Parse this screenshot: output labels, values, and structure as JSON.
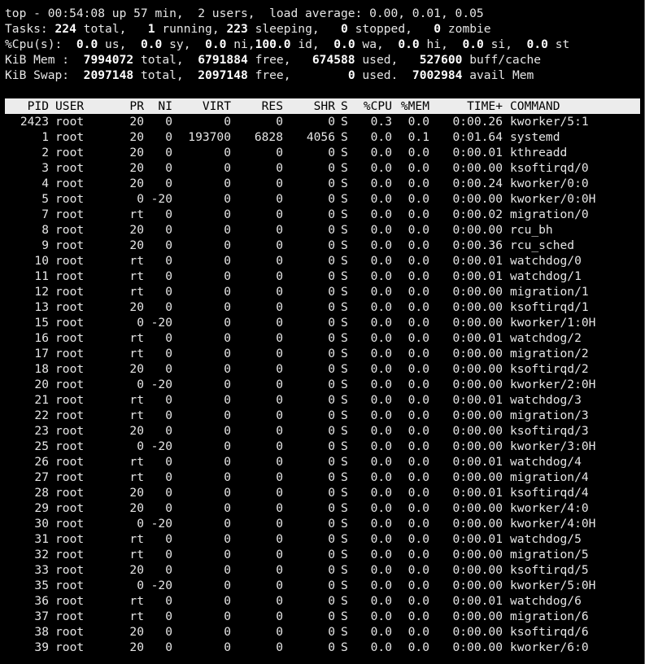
{
  "summary": {
    "line1": "top - 00:54:08 up 57 min,  2 users,  load average: 0.00, 0.01, 0.05",
    "tasks": {
      "label": "Tasks:",
      "total": "224",
      "total_label": "total,",
      "running": "1",
      "running_label": "running,",
      "sleeping": "223",
      "sleeping_label": "sleeping,",
      "stopped": "0",
      "stopped_label": "stopped,",
      "zombie": "0",
      "zombie_label": "zombie"
    },
    "cpu": {
      "label": "%Cpu(s):",
      "us": "0.0",
      "us_label": "us,",
      "sy": "0.0",
      "sy_label": "sy,",
      "ni": "0.0",
      "ni_label": "ni,",
      "id": "100.0",
      "id_label": "id,",
      "wa": "0.0",
      "wa_label": "wa,",
      "hi": "0.0",
      "hi_label": "hi,",
      "si": "0.0",
      "si_label": "si,",
      "st": "0.0",
      "st_label": "st"
    },
    "mem": {
      "label": "KiB Mem :",
      "total": "7994072",
      "total_label": "total,",
      "free": "6791884",
      "free_label": "free,",
      "used": "674588",
      "used_label": "used,",
      "buff": "527600",
      "buff_label": "buff/cache"
    },
    "swap": {
      "label": "KiB Swap:",
      "total": "2097148",
      "total_label": "total,",
      "free": "2097148",
      "free_label": "free,",
      "used": "0",
      "used_label": "used.",
      "avail": "7002984",
      "avail_label": "avail Mem"
    }
  },
  "columns": {
    "pid": "PID",
    "user": "USER",
    "pr": "PR",
    "ni": "NI",
    "virt": "VIRT",
    "res": "RES",
    "shr": "SHR",
    "s": "S",
    "cpu": "%CPU",
    "mem": "%MEM",
    "time": "TIME+",
    "command": "COMMAND"
  },
  "processes": [
    [
      "2423",
      "root",
      "20",
      "0",
      "0",
      "0",
      "0",
      "S",
      "0.3",
      "0.0",
      "0:00.26",
      "kworker/5:1"
    ],
    [
      "1",
      "root",
      "20",
      "0",
      "193700",
      "6828",
      "4056",
      "S",
      "0.0",
      "0.1",
      "0:01.64",
      "systemd"
    ],
    [
      "2",
      "root",
      "20",
      "0",
      "0",
      "0",
      "0",
      "S",
      "0.0",
      "0.0",
      "0:00.01",
      "kthreadd"
    ],
    [
      "3",
      "root",
      "20",
      "0",
      "0",
      "0",
      "0",
      "S",
      "0.0",
      "0.0",
      "0:00.00",
      "ksoftirqd/0"
    ],
    [
      "4",
      "root",
      "20",
      "0",
      "0",
      "0",
      "0",
      "S",
      "0.0",
      "0.0",
      "0:00.24",
      "kworker/0:0"
    ],
    [
      "5",
      "root",
      "0",
      "-20",
      "0",
      "0",
      "0",
      "S",
      "0.0",
      "0.0",
      "0:00.00",
      "kworker/0:0H"
    ],
    [
      "7",
      "root",
      "rt",
      "0",
      "0",
      "0",
      "0",
      "S",
      "0.0",
      "0.0",
      "0:00.02",
      "migration/0"
    ],
    [
      "8",
      "root",
      "20",
      "0",
      "0",
      "0",
      "0",
      "S",
      "0.0",
      "0.0",
      "0:00.00",
      "rcu_bh"
    ],
    [
      "9",
      "root",
      "20",
      "0",
      "0",
      "0",
      "0",
      "S",
      "0.0",
      "0.0",
      "0:00.36",
      "rcu_sched"
    ],
    [
      "10",
      "root",
      "rt",
      "0",
      "0",
      "0",
      "0",
      "S",
      "0.0",
      "0.0",
      "0:00.01",
      "watchdog/0"
    ],
    [
      "11",
      "root",
      "rt",
      "0",
      "0",
      "0",
      "0",
      "S",
      "0.0",
      "0.0",
      "0:00.01",
      "watchdog/1"
    ],
    [
      "12",
      "root",
      "rt",
      "0",
      "0",
      "0",
      "0",
      "S",
      "0.0",
      "0.0",
      "0:00.00",
      "migration/1"
    ],
    [
      "13",
      "root",
      "20",
      "0",
      "0",
      "0",
      "0",
      "S",
      "0.0",
      "0.0",
      "0:00.00",
      "ksoftirqd/1"
    ],
    [
      "15",
      "root",
      "0",
      "-20",
      "0",
      "0",
      "0",
      "S",
      "0.0",
      "0.0",
      "0:00.00",
      "kworker/1:0H"
    ],
    [
      "16",
      "root",
      "rt",
      "0",
      "0",
      "0",
      "0",
      "S",
      "0.0",
      "0.0",
      "0:00.01",
      "watchdog/2"
    ],
    [
      "17",
      "root",
      "rt",
      "0",
      "0",
      "0",
      "0",
      "S",
      "0.0",
      "0.0",
      "0:00.00",
      "migration/2"
    ],
    [
      "18",
      "root",
      "20",
      "0",
      "0",
      "0",
      "0",
      "S",
      "0.0",
      "0.0",
      "0:00.00",
      "ksoftirqd/2"
    ],
    [
      "20",
      "root",
      "0",
      "-20",
      "0",
      "0",
      "0",
      "S",
      "0.0",
      "0.0",
      "0:00.00",
      "kworker/2:0H"
    ],
    [
      "21",
      "root",
      "rt",
      "0",
      "0",
      "0",
      "0",
      "S",
      "0.0",
      "0.0",
      "0:00.01",
      "watchdog/3"
    ],
    [
      "22",
      "root",
      "rt",
      "0",
      "0",
      "0",
      "0",
      "S",
      "0.0",
      "0.0",
      "0:00.00",
      "migration/3"
    ],
    [
      "23",
      "root",
      "20",
      "0",
      "0",
      "0",
      "0",
      "S",
      "0.0",
      "0.0",
      "0:00.00",
      "ksoftirqd/3"
    ],
    [
      "25",
      "root",
      "0",
      "-20",
      "0",
      "0",
      "0",
      "S",
      "0.0",
      "0.0",
      "0:00.00",
      "kworker/3:0H"
    ],
    [
      "26",
      "root",
      "rt",
      "0",
      "0",
      "0",
      "0",
      "S",
      "0.0",
      "0.0",
      "0:00.01",
      "watchdog/4"
    ],
    [
      "27",
      "root",
      "rt",
      "0",
      "0",
      "0",
      "0",
      "S",
      "0.0",
      "0.0",
      "0:00.00",
      "migration/4"
    ],
    [
      "28",
      "root",
      "20",
      "0",
      "0",
      "0",
      "0",
      "S",
      "0.0",
      "0.0",
      "0:00.01",
      "ksoftirqd/4"
    ],
    [
      "29",
      "root",
      "20",
      "0",
      "0",
      "0",
      "0",
      "S",
      "0.0",
      "0.0",
      "0:00.00",
      "kworker/4:0"
    ],
    [
      "30",
      "root",
      "0",
      "-20",
      "0",
      "0",
      "0",
      "S",
      "0.0",
      "0.0",
      "0:00.00",
      "kworker/4:0H"
    ],
    [
      "31",
      "root",
      "rt",
      "0",
      "0",
      "0",
      "0",
      "S",
      "0.0",
      "0.0",
      "0:00.01",
      "watchdog/5"
    ],
    [
      "32",
      "root",
      "rt",
      "0",
      "0",
      "0",
      "0",
      "S",
      "0.0",
      "0.0",
      "0:00.00",
      "migration/5"
    ],
    [
      "33",
      "root",
      "20",
      "0",
      "0",
      "0",
      "0",
      "S",
      "0.0",
      "0.0",
      "0:00.00",
      "ksoftirqd/5"
    ],
    [
      "35",
      "root",
      "0",
      "-20",
      "0",
      "0",
      "0",
      "S",
      "0.0",
      "0.0",
      "0:00.00",
      "kworker/5:0H"
    ],
    [
      "36",
      "root",
      "rt",
      "0",
      "0",
      "0",
      "0",
      "S",
      "0.0",
      "0.0",
      "0:00.01",
      "watchdog/6"
    ],
    [
      "37",
      "root",
      "rt",
      "0",
      "0",
      "0",
      "0",
      "S",
      "0.0",
      "0.0",
      "0:00.00",
      "migration/6"
    ],
    [
      "38",
      "root",
      "20",
      "0",
      "0",
      "0",
      "0",
      "S",
      "0.0",
      "0.0",
      "0:00.00",
      "ksoftirqd/6"
    ],
    [
      "39",
      "root",
      "20",
      "0",
      "0",
      "0",
      "0",
      "S",
      "0.0",
      "0.0",
      "0:00.00",
      "kworker/6:0"
    ]
  ]
}
